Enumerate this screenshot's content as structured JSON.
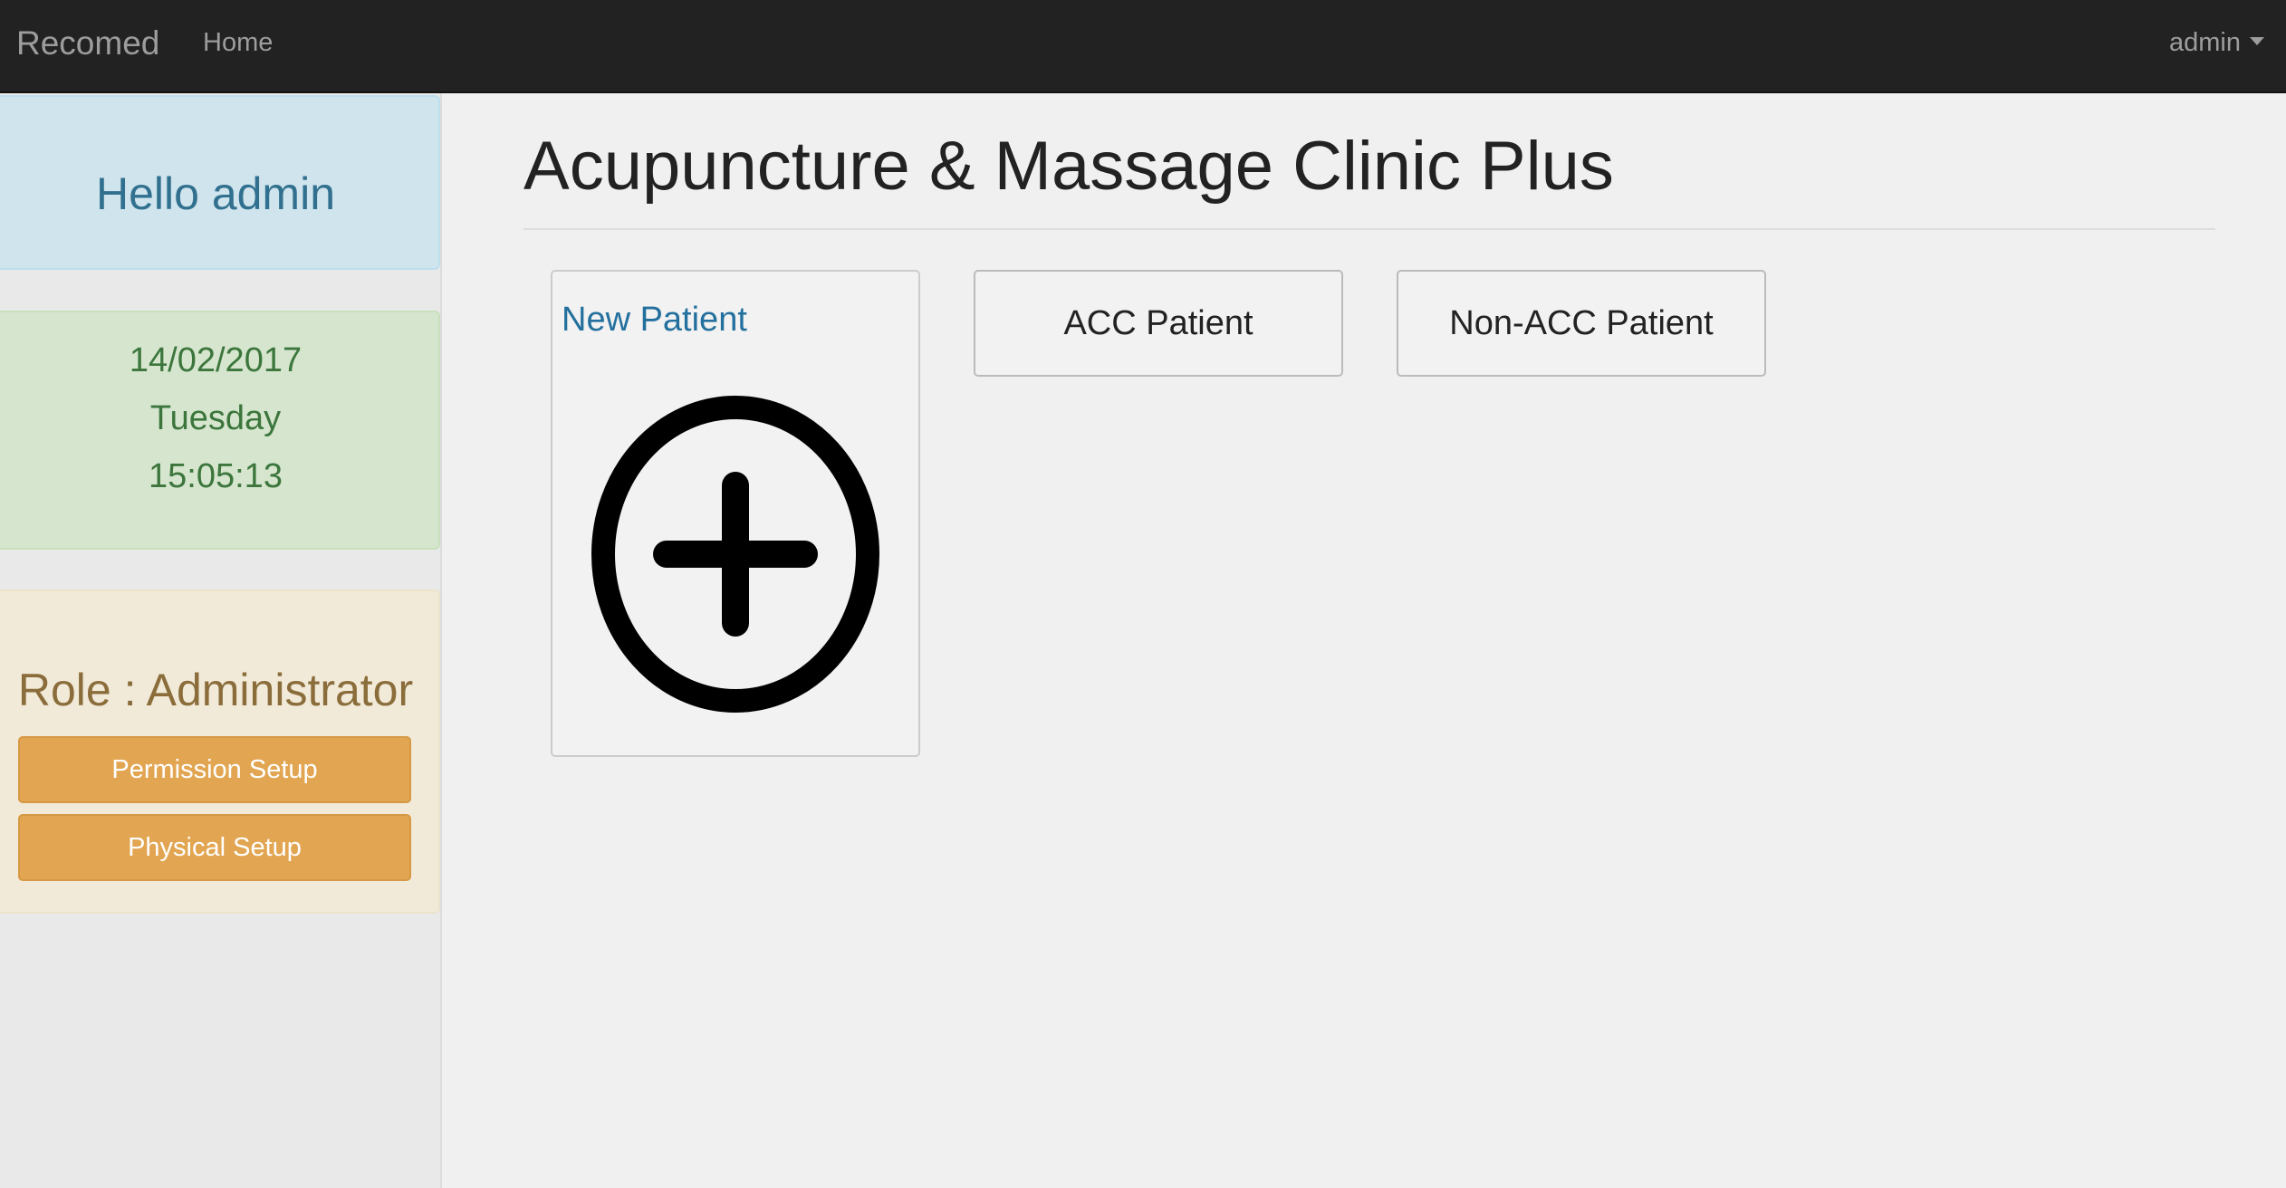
{
  "navbar": {
    "brand": "Recomed",
    "home_label": "Home",
    "user_label": "admin"
  },
  "sidebar": {
    "greeting": "Hello admin",
    "date": "14/02/2017",
    "weekday": "Tuesday",
    "time": "15:05:13",
    "role": "Role : Administrator",
    "permission_setup_label": "Permission Setup",
    "physical_setup_label": "Physical Setup"
  },
  "main": {
    "title": "Acupuncture & Massage Clinic Plus",
    "new_patient_label": "New Patient",
    "new_patient_icon": "plus-circle-icon",
    "acc_patient_label": "ACC Patient",
    "non_acc_patient_label": "Non-ACC Patient"
  },
  "colors": {
    "navbar_bg": "#222222",
    "info_panel_bg": "#d0e4ed",
    "success_panel_bg": "#d6e6ce",
    "warning_panel_bg": "#f2ead8",
    "warning_button": "#e2a551",
    "link_blue": "#23709e"
  }
}
